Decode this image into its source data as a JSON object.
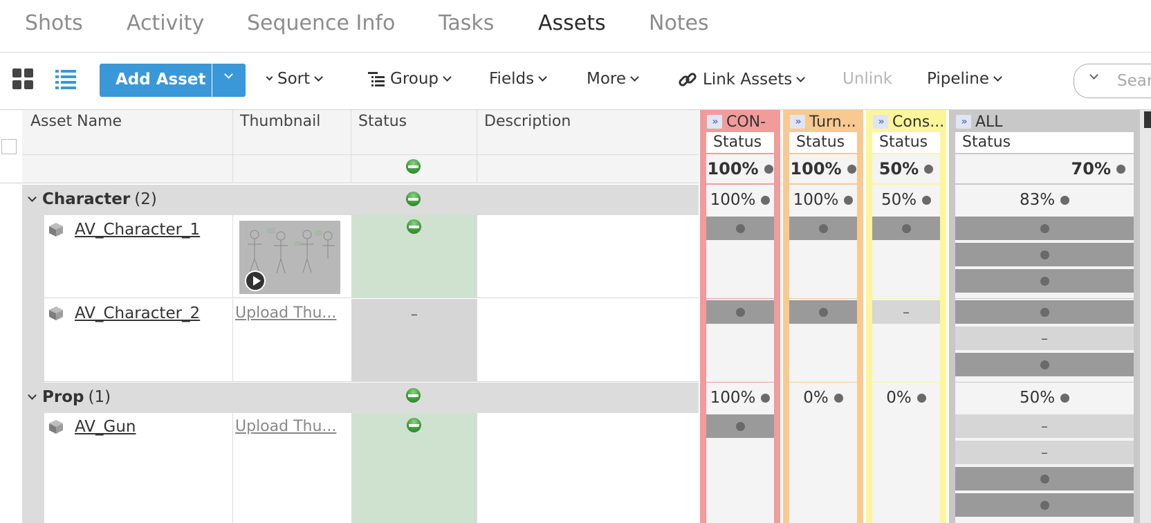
{
  "tabs": [
    {
      "label": "Shots"
    },
    {
      "label": "Activity"
    },
    {
      "label": "Sequence Info"
    },
    {
      "label": "Tasks"
    },
    {
      "label": "Assets"
    },
    {
      "label": "Notes"
    }
  ],
  "toolbar": {
    "add_asset": "Add Asset",
    "sort": "Sort",
    "group": "Group",
    "fields": "Fields",
    "more": "More",
    "link_assets": "Link Assets",
    "unlink": "Unlink",
    "pipeline": "Pipeline",
    "search_placeholder": "Sear"
  },
  "columns": {
    "asset_name": "Asset Name",
    "thumbnail": "Thumbnail",
    "status": "Status",
    "description": "Description"
  },
  "pipeline_steps": [
    {
      "label": "CON-",
      "sub": "Status",
      "summary": "100%",
      "color": "#f29b9b"
    },
    {
      "label": "Turn...",
      "sub": "Status",
      "summary": "100%",
      "color": "#f8c990"
    },
    {
      "label": "Cons...",
      "sub": "Status",
      "summary": "50%",
      "color": "#fdf59c"
    },
    {
      "label": "ALL",
      "sub": "Status",
      "summary": "70%",
      "color": "#c8c8c8"
    }
  ],
  "groups": [
    {
      "name": "Character",
      "count": "(2)",
      "pcts": [
        "100%",
        "100%",
        "50%",
        "83%"
      ],
      "assets": [
        {
          "name": "AV_Character_1",
          "thumbnail": "",
          "status_bg": "#cfe2cf"
        },
        {
          "name": "AV_Character_2",
          "thumbnail": "Upload Thu...",
          "status": "–",
          "status_bg": "#d6d6d6"
        }
      ]
    },
    {
      "name": "Prop",
      "count": "(1)",
      "pcts": [
        "100%",
        "0%",
        "0%",
        "50%"
      ],
      "assets": [
        {
          "name": "AV_Gun",
          "thumbnail": "Upload Thu...",
          "status_bg": "#cfe2cf"
        }
      ]
    }
  ],
  "cell_dash": "–",
  "colors": {
    "accent": "#3a97d8",
    "status_green": "#3e9a3a",
    "task_dark": "#9a9a9a",
    "task_light": "#d6d6d6"
  }
}
